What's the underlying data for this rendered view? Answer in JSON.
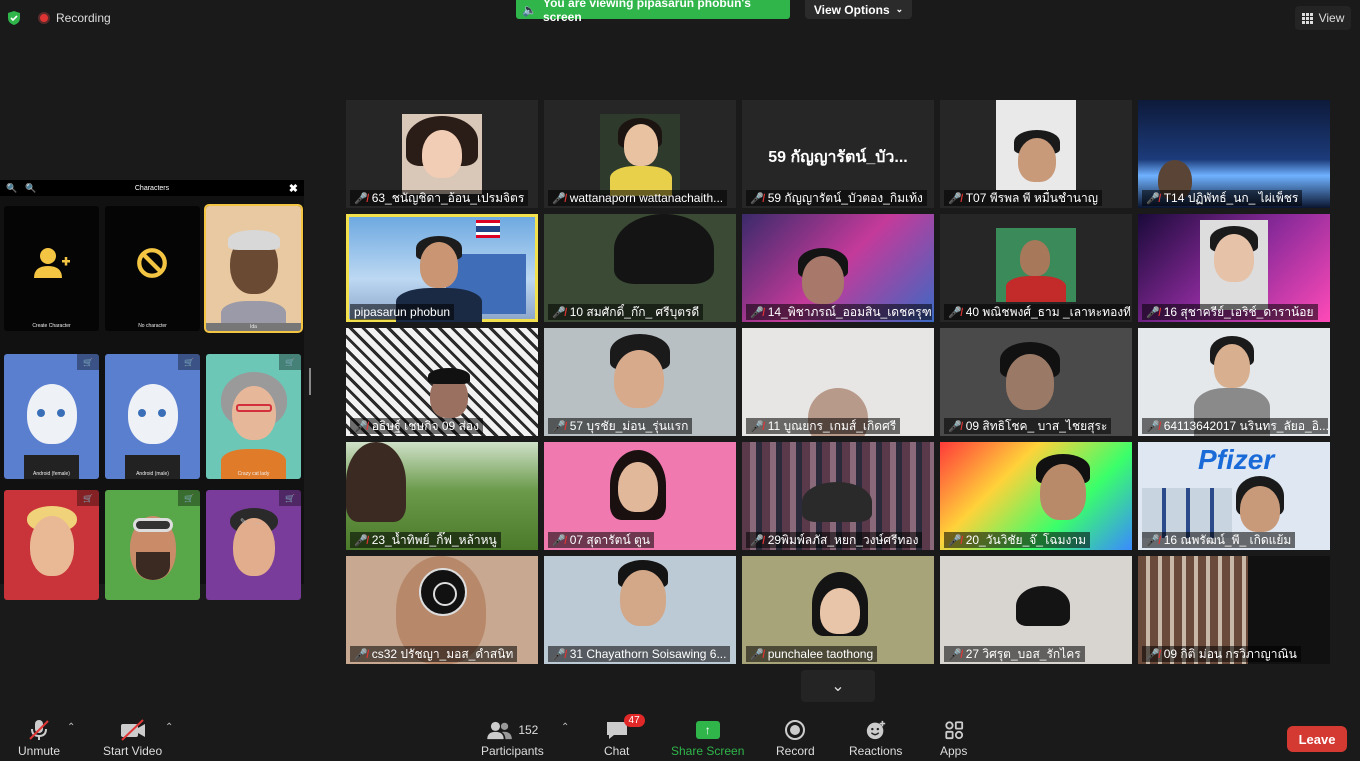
{
  "top_bar": {
    "recording_label": "Recording",
    "viewing_banner": "You are viewing pipasarun phobun's screen",
    "view_options_label": "View Options",
    "view_label": "View"
  },
  "characters_panel": {
    "title": "Characters",
    "items": [
      {
        "label": "Create Character"
      },
      {
        "label": "No character"
      },
      {
        "label": "Ida"
      },
      {
        "label": "Android (female)"
      },
      {
        "label": "Android (male)"
      },
      {
        "label": "Crazy cat lady"
      },
      {
        "label": ""
      },
      {
        "label": ""
      },
      {
        "label": ""
      }
    ]
  },
  "participants": [
    {
      "name": "63_ชนัญชิดา_อ้อน_เปรมจิตร"
    },
    {
      "name": "wattanaporn wattanachaith..."
    },
    {
      "name": "59 กัญญารัตน์_บัวตอง_กิมเท้ง",
      "display_name": "59 กัญญารัตน์_บัว..."
    },
    {
      "name": "T07 พีรพล พี หมื่นชำนาญ"
    },
    {
      "name": "T14 ปฏิพัทธ์_นก_ ไผ่เพ็ชร"
    },
    {
      "name": "pipasarun phobun"
    },
    {
      "name": "10 สมศักดิ์_ก๊ก_ ศรีบุตรดี"
    },
    {
      "name": "14_พิชาภรณ์_ออมสิน_เดชครุฑ"
    },
    {
      "name": "40 พณิชพงศ์_ธาม _เลาหะทองที..."
    },
    {
      "name": "16 สุชาครีย์_เอริช์_ดาราน้อย"
    },
    {
      "name": "อธิษฐ์ เชษกิจ 09 ส่อง"
    },
    {
      "name": "57 บุรชัย_ม่อน_รุ่นแรก"
    },
    {
      "name": "11 บูณยกร_เกมส์_เกิดศรี"
    },
    {
      "name": "09 สิทธิโชค_ บาส_ไชยสุระ"
    },
    {
      "name": "64113642017 นรินทร_ลัยอ_อิ..."
    },
    {
      "name": "23_น้ำทิพย์_กิ๊ฟ_หล้าหนู"
    },
    {
      "name": "07 สุดารัตน์ ตูน"
    },
    {
      "name": "29พิมพ์ลภัส_หยก_วงษ์ศรีทอง"
    },
    {
      "name": "20_วันวิชัย_จ๊_โฉมงาม"
    },
    {
      "name": "16 ณพรัฒน์_พี_ เกิดแย้ม"
    },
    {
      "name": "cs32 ปรัชญา_มอส_ดำสนิท"
    },
    {
      "name": "31 Chayathorn Soisawing 6..."
    },
    {
      "name": "punchalee taothong"
    },
    {
      "name": "27 วิศรุต_บอส_รักไคร"
    },
    {
      "name": "09 กิติ ม่อน กรวิภาญาณิน"
    }
  ],
  "toolbar": {
    "unmute_label": "Unmute",
    "start_video_label": "Start Video",
    "participants_label": "Participants",
    "participants_count": "152",
    "chat_label": "Chat",
    "chat_badge": "47",
    "share_screen_label": "Share Screen",
    "record_label": "Record",
    "reactions_label": "Reactions",
    "apps_label": "Apps",
    "leave_label": "Leave"
  },
  "colors": {
    "accent_green": "#2fb54a",
    "leave_red": "#d43a32",
    "active_speaker": "#f2e04d"
  }
}
